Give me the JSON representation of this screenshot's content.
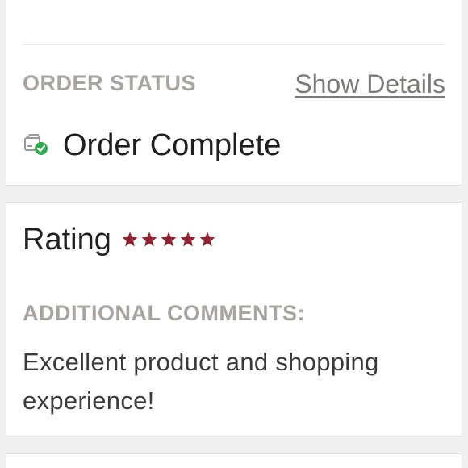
{
  "order_status": {
    "label": "ORDER STATUS",
    "show_details_link": "Show Details",
    "status_text": "Order Complete",
    "status_icon": "package-check-icon",
    "status_icon_color": "#2fa84f"
  },
  "rating": {
    "label": "Rating",
    "stars_filled": 5,
    "stars_total": 5,
    "star_color": "#8c2433"
  },
  "comments": {
    "label": "ADDITIONAL COMMENTS:",
    "text": "Excellent product and shopping experience!"
  }
}
